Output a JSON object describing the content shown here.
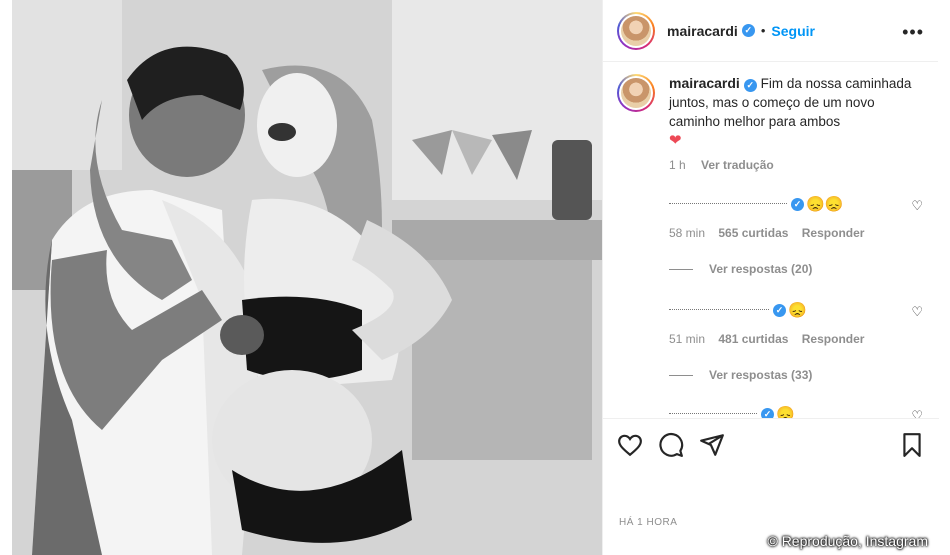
{
  "post": {
    "username": "mairacardi",
    "follow_label": "Seguir",
    "dot": "•",
    "more": "•••"
  },
  "caption": {
    "username": "mairacardi",
    "text": "Fim da nossa caminhada juntos, mas o começo de um novo caminho melhor para ambos",
    "emoji": "❤",
    "time": "1 h",
    "translate": "Ver tradução"
  },
  "comments": [
    {
      "emojis": "😞😞",
      "time": "58 min",
      "likes": "565 curtidas",
      "reply": "Responder",
      "view_replies": "Ver respostas (20)"
    },
    {
      "emojis": "😞",
      "time": "51 min",
      "likes": "481 curtidas",
      "reply": "Responder",
      "view_replies": "Ver respostas (33)"
    },
    {
      "emojis": "😞"
    }
  ],
  "footer": {
    "timestamp": "HÁ 1 HORA",
    "credit": "© Reprodução, Instagram"
  },
  "icons": [
    "heart-icon",
    "comment-icon",
    "share-icon",
    "bookmark-icon",
    "verified-icon",
    "more-icon"
  ],
  "colors": {
    "link": "#0095f6",
    "verified": "#3897f0",
    "muted": "#8e8e8e",
    "heart": "#ed4956"
  }
}
